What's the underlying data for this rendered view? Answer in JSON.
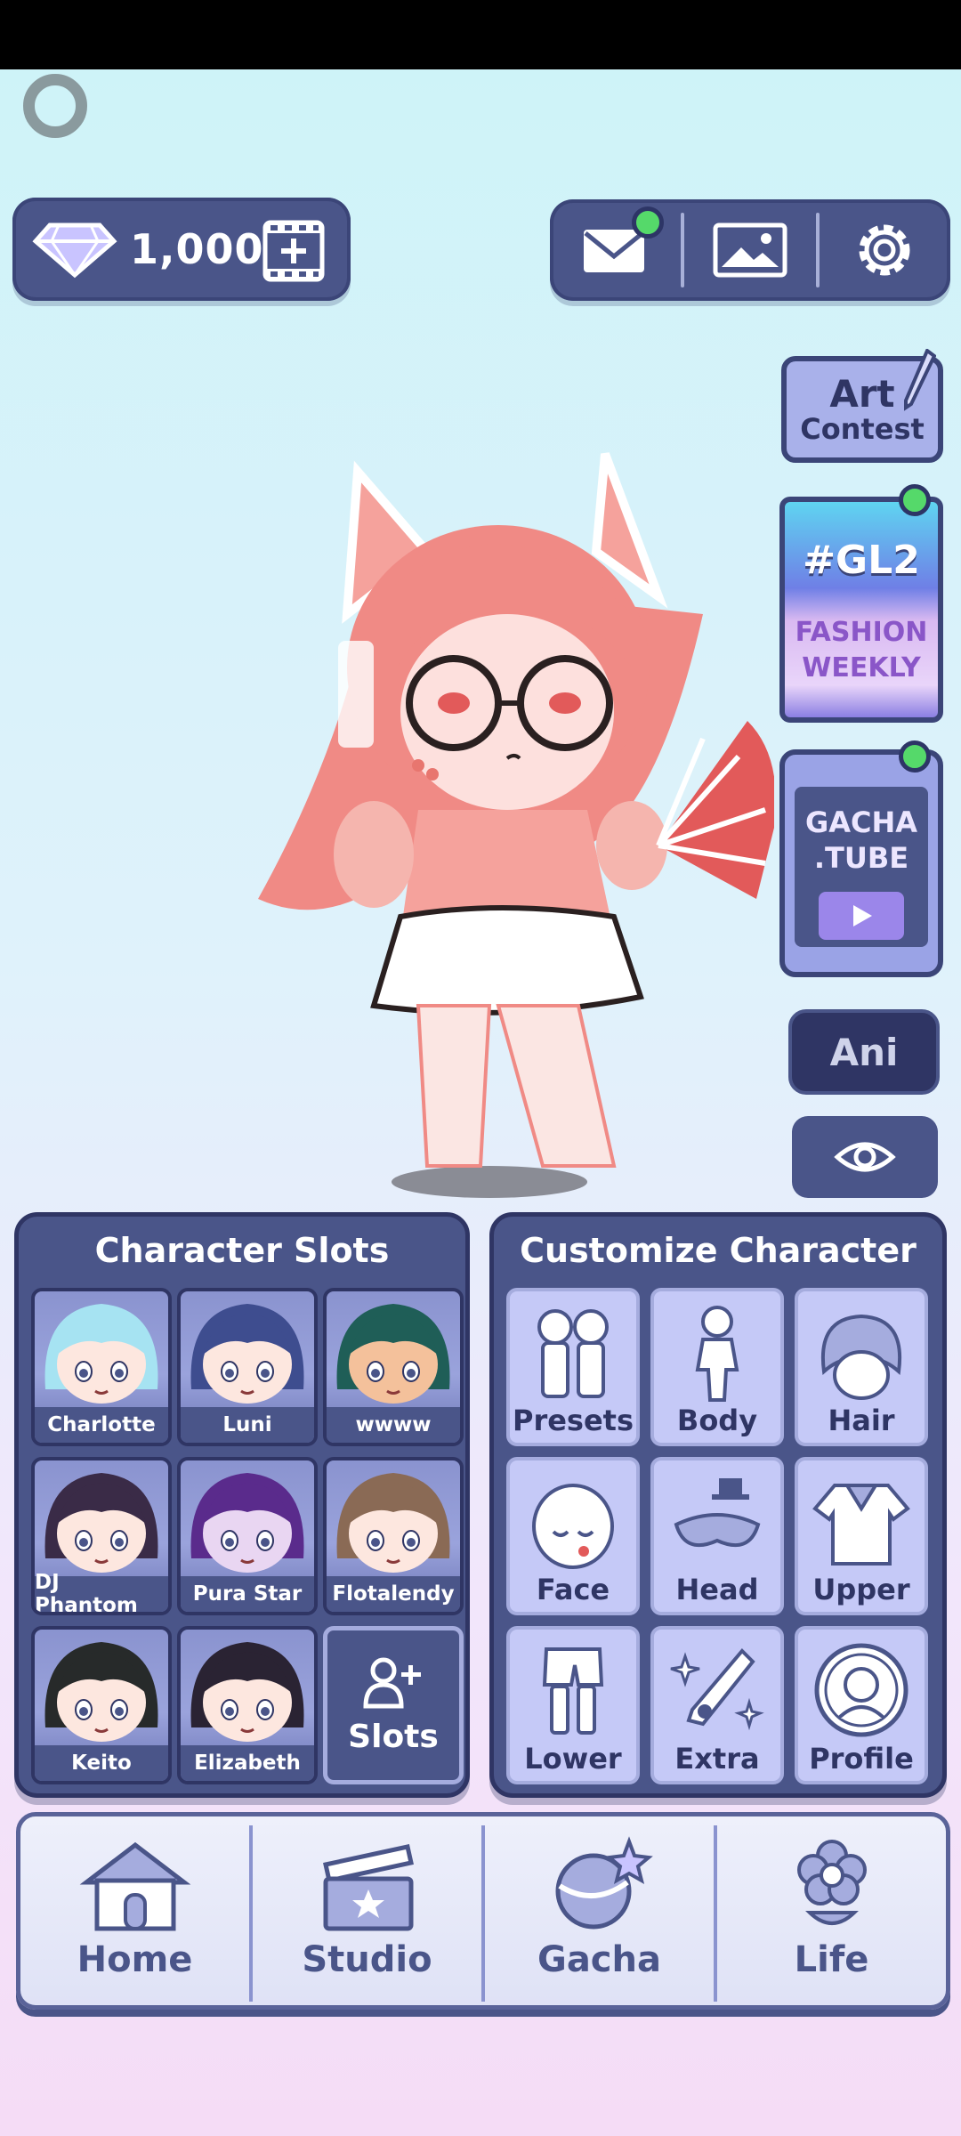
{
  "currency": {
    "amount": "1,000",
    "icon": "diamond-icon",
    "add_icon": "add-film-icon"
  },
  "top_right": {
    "icons": [
      "mail-icon",
      "gallery-icon",
      "settings-icon"
    ],
    "mail_notification": true
  },
  "side_buttons": {
    "art_contest": {
      "line1": "Art",
      "line2": "Contest"
    },
    "fashion": {
      "title": "#GL2",
      "line1": "FASHION",
      "line2": "WEEKLY",
      "notification": true
    },
    "gacha_tube": {
      "line1": "GACHA",
      "line2": ".TUBE",
      "notification": true
    },
    "ani": "Ani",
    "eye_icon": "eye-icon"
  },
  "character_slots": {
    "title": "Character Slots",
    "slots": [
      {
        "name": "Charlotte",
        "hair": "#a6e3f2",
        "skin": "#fde7df"
      },
      {
        "name": "Luni",
        "hair": "#3e4d8f",
        "skin": "#fde7df"
      },
      {
        "name": "wwww",
        "hair": "#1f5e57",
        "skin": "#f4c19b"
      },
      {
        "name": "DJ Phantom",
        "hair": "#3a2b47",
        "skin": "#fde7df"
      },
      {
        "name": "Pura Star",
        "hair": "#5a2b8c",
        "skin": "#e9d6f2"
      },
      {
        "name": "Flotalendy",
        "hair": "#8a6a55",
        "skin": "#fde7df"
      },
      {
        "name": "Keito",
        "hair": "#272a2a",
        "skin": "#fde7df"
      },
      {
        "name": "Elizabeth",
        "hair": "#2a2333",
        "skin": "#fde7df"
      }
    ],
    "add_label": "Slots"
  },
  "customize": {
    "title": "Customize Character",
    "items": [
      {
        "label": "Presets",
        "icon": "presets-icon"
      },
      {
        "label": "Body",
        "icon": "body-icon"
      },
      {
        "label": "Hair",
        "icon": "hair-icon"
      },
      {
        "label": "Face",
        "icon": "face-icon"
      },
      {
        "label": "Head",
        "icon": "head-icon"
      },
      {
        "label": "Upper",
        "icon": "upper-icon"
      },
      {
        "label": "Lower",
        "icon": "lower-icon"
      },
      {
        "label": "Extra",
        "icon": "extra-icon"
      },
      {
        "label": "Profile",
        "icon": "profile-icon"
      }
    ]
  },
  "nav": [
    {
      "label": "Home",
      "icon": "home-icon"
    },
    {
      "label": "Studio",
      "icon": "clapperboard-icon"
    },
    {
      "label": "Gacha",
      "icon": "gacha-icon"
    },
    {
      "label": "Life",
      "icon": "flower-icon"
    }
  ],
  "colors": {
    "panel": "#4a5589",
    "accent_green": "#55d96a",
    "character_tint": "#f08a85"
  }
}
